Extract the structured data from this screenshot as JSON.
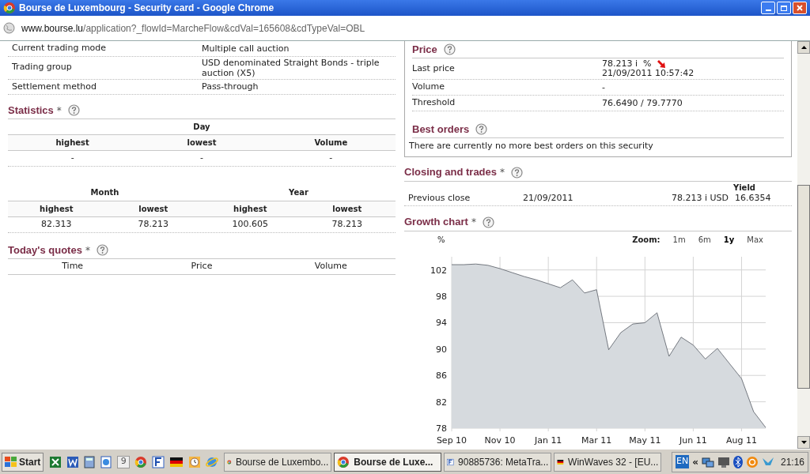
{
  "window": {
    "title": "Bourse de Luxembourg - Security card - Google Chrome"
  },
  "address_bar": {
    "host": "www.bourse.lu",
    "path": "/application?_flowId=MarcheFlow&cdVal=165608&cdTypeVal=OBL"
  },
  "details": [
    {
      "label": "Current trading mode",
      "value": "Multiple call auction"
    },
    {
      "label": "Trading group",
      "value": "USD denominated Straight Bonds - triple auction (X5)"
    },
    {
      "label": "Settlement method",
      "value": "Pass-through"
    }
  ],
  "statistics": {
    "title": "Statistics",
    "mark": "*",
    "day": {
      "heading": "Day",
      "columns": [
        "highest",
        "lowest",
        "Volume"
      ],
      "values": [
        "-",
        "-",
        "-"
      ]
    },
    "periods": [
      {
        "heading": "Month",
        "columns": [
          "highest",
          "lowest"
        ],
        "values": [
          "82.313",
          "78.213"
        ]
      },
      {
        "heading": "Year",
        "columns": [
          "highest",
          "lowest"
        ],
        "values": [
          "100.605",
          "78.213"
        ]
      }
    ]
  },
  "todays_quotes": {
    "title": "Today's quotes",
    "mark": "*",
    "columns": [
      "Time",
      "Price",
      "Volume"
    ]
  },
  "price": {
    "title": "Price",
    "rows": [
      {
        "label": "Last price",
        "value": "78.213 i  %",
        "falling": true,
        "time": "21/09/2011 10:57:42"
      },
      {
        "label": "Volume",
        "value": "-"
      },
      {
        "label": "Threshold",
        "value": "76.6490 / 79.7770"
      }
    ]
  },
  "best_orders": {
    "title": "Best orders",
    "message": "There are currently no more best orders on this security"
  },
  "closing_and_trades": {
    "title": "Closing and trades",
    "mark": "*",
    "yield_heading": "Yield",
    "row": [
      "Previous close",
      "21/09/2011",
      "78.213 i USD",
      "16.6354"
    ]
  },
  "growth_chart": {
    "title": "Growth chart",
    "mark": "*",
    "zoom_label": "Zoom:",
    "zoom_options": [
      {
        "label": "1m",
        "selected": false
      },
      {
        "label": "6m",
        "selected": false
      },
      {
        "label": "1y",
        "selected": true
      },
      {
        "label": "Max",
        "selected": false
      }
    ],
    "chart_data": {
      "type": "area",
      "ylabel": "%",
      "categories": [
        "Sep 10",
        null,
        null,
        null,
        "Nov 10",
        null,
        null,
        null,
        "Jan 11",
        null,
        null,
        null,
        "Mar 11",
        null,
        null,
        null,
        "May 11",
        null,
        null,
        null,
        "Jun 11",
        null,
        null,
        null,
        "Aug 11",
        null,
        null
      ],
      "series": [
        {
          "color": "#555b63",
          "values": [
            102.8,
            102.8,
            102.9,
            102.7,
            102.2,
            101.6,
            101.0,
            100.5,
            99.9,
            99.3,
            100.5,
            98.5,
            99.0,
            89.9,
            92.5,
            93.8,
            94.0,
            95.5,
            88.9,
            91.8,
            90.6,
            88.5,
            90.1,
            87.8,
            85.5,
            80.5,
            78.1
          ]
        }
      ],
      "ylim": [
        78,
        104
      ],
      "grid": true,
      "yticks": [
        78,
        82,
        86,
        90,
        94,
        98,
        102
      ]
    }
  },
  "taskbar": {
    "start_label": "Start",
    "quick_launch": [
      {
        "kind": "excel"
      },
      {
        "kind": "word"
      },
      {
        "kind": "calc"
      },
      {
        "kind": "doc"
      },
      {
        "kind": "badge",
        "label": "9"
      },
      {
        "kind": "chrome"
      },
      {
        "kind": "forex"
      },
      {
        "kind": "flag"
      },
      {
        "kind": "clock"
      },
      {
        "kind": "ie"
      }
    ],
    "tasks": [
      {
        "kind": "chrome",
        "label": "Bourse de Luxembo...",
        "selected": false
      },
      {
        "kind": "chrome",
        "label": "Bourse de Luxe...",
        "selected": true
      },
      {
        "kind": "forex",
        "label": "90885736: MetaTra...",
        "selected": false
      },
      {
        "kind": "flag",
        "label": "WinWaves 32 - [EU...",
        "selected": false
      }
    ],
    "language": "EN",
    "expand": "«",
    "clock": "21:16"
  }
}
